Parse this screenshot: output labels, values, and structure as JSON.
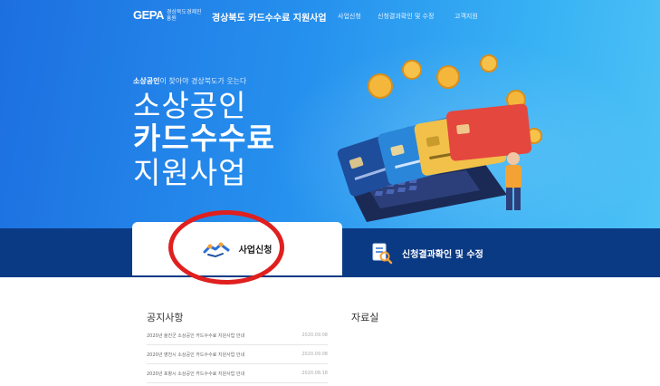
{
  "header": {
    "logo_mark": "GEPA",
    "logo_org": "경상북도경제진흥원",
    "site_title": "경상북도 카드수수료 지원사업",
    "nav": [
      {
        "label": "사업신청"
      },
      {
        "label": "신청결과확인 및 수정"
      },
      {
        "label": "고객지원"
      }
    ]
  },
  "hero": {
    "tagline_bold": "소상공인",
    "tagline_rest": "이 찾아야 경상북도가 웃는다",
    "line1": "소상공인",
    "line2": "카드수수료",
    "line3": "지원사업"
  },
  "tabs": {
    "apply_label": "사업신청",
    "result_label": "신청결과확인 및 수정"
  },
  "notice": {
    "title": "공지사항",
    "rows": [
      {
        "title": "2020년 울진군 소상공인 카드수수료 지원사업 안내",
        "date": "2020.09.08"
      },
      {
        "title": "2020년 영천시 소상공인 카드수수료 지원사업 안내",
        "date": "2020.09.08"
      },
      {
        "title": "2020년 포항시 소상공인 카드수수료 지원사업 안내",
        "date": "2020.08.18"
      }
    ]
  },
  "archive": {
    "title": "자료실"
  },
  "colors": {
    "hero_start": "#1d6fe0",
    "hero_end": "#4fc3f6",
    "tabbar": "#0b3a85",
    "highlight_circle": "#e01f1f"
  }
}
